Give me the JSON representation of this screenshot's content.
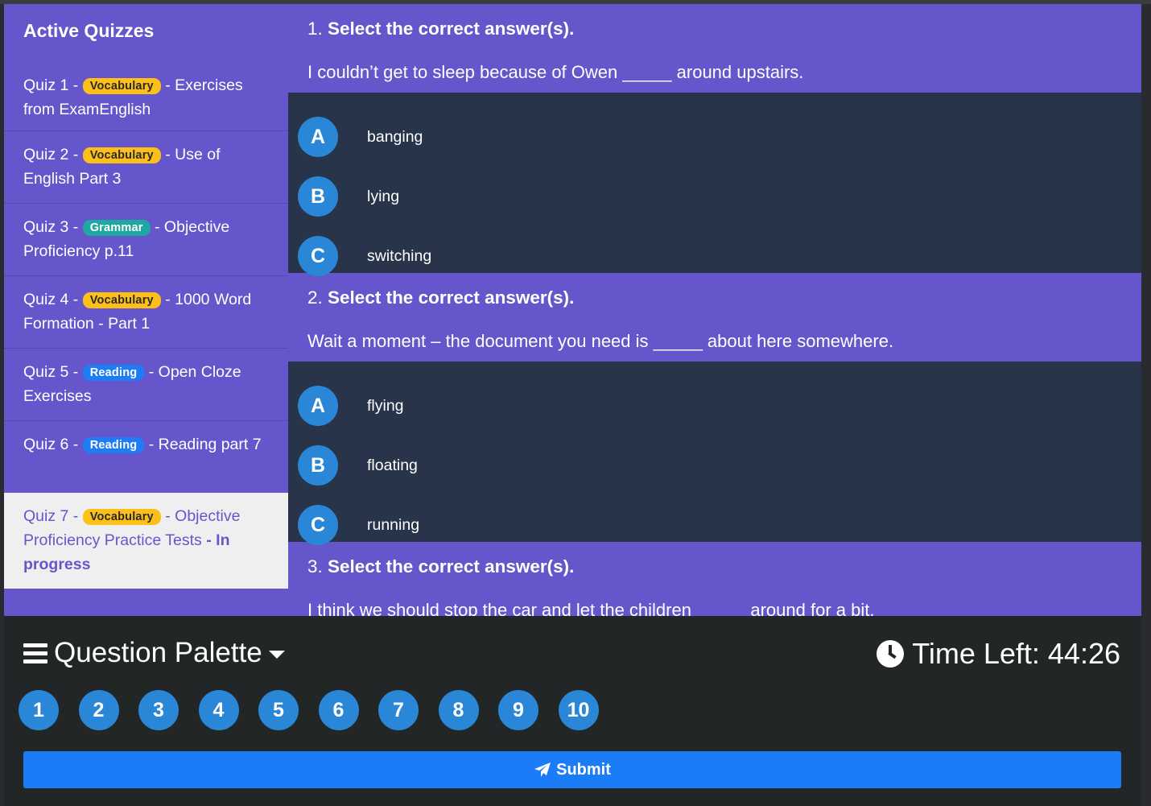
{
  "sidebar": {
    "title": "Active Quizzes",
    "items": [
      {
        "prefix": "Quiz 1 -",
        "badge": "Vocabulary",
        "rest": "- Exercises from ExamEnglish",
        "status": ""
      },
      {
        "prefix": "Quiz 2 -",
        "badge": "Vocabulary",
        "rest": "- Use of English Part 3",
        "status": ""
      },
      {
        "prefix": "Quiz 3 -",
        "badge": "Grammar",
        "rest": "- Objective Proficiency p.11",
        "status": ""
      },
      {
        "prefix": "Quiz 4 -",
        "badge": "Vocabulary",
        "rest": "- 1000 Word Formation - Part 1",
        "status": ""
      },
      {
        "prefix": "Quiz 5 -",
        "badge": "Reading",
        "rest": "- Open Cloze Exercises",
        "status": ""
      },
      {
        "prefix": "Quiz 6 -",
        "badge": "Reading",
        "rest": "- Reading part 7",
        "status": ""
      },
      {
        "prefix": "Quiz 7 -",
        "badge": "Vocabulary",
        "rest": "- Objective Proficiency Practice Tests",
        "status": "- In progress"
      }
    ]
  },
  "questions": [
    {
      "number": "1.",
      "title": "Select the correct answer(s).",
      "text": "I couldn’t get to sleep because of Owen _____ around upstairs.",
      "options": [
        {
          "letter": "A",
          "text": "banging"
        },
        {
          "letter": "B",
          "text": "lying"
        },
        {
          "letter": "C",
          "text": "switching"
        }
      ]
    },
    {
      "number": "2.",
      "title": "Select the correct answer(s).",
      "text": "Wait a moment – the document you need is _____ about here somewhere.",
      "options": [
        {
          "letter": "A",
          "text": "flying"
        },
        {
          "letter": "B",
          "text": "floating"
        },
        {
          "letter": "C",
          "text": "running"
        }
      ]
    },
    {
      "number": "3.",
      "title": "Select the correct answer(s).",
      "text": "I think we should stop the car and let the children _____ around for a bit."
    }
  ],
  "palette": {
    "title": "Question Palette",
    "numbers": [
      "1",
      "2",
      "3",
      "4",
      "5",
      "6",
      "7",
      "8",
      "9",
      "10"
    ]
  },
  "timer": {
    "label": "Time Left: 44:26"
  },
  "submit": {
    "label": "Submit"
  },
  "colors": {
    "accent": "#6656cc",
    "option_bg": "#273449",
    "circle": "#2a87d8",
    "submit": "#1a7cf6",
    "badge_vocabulary": "#fdc019",
    "badge_grammar": "#1fa7a1",
    "badge_reading": "#1e7cf5"
  },
  "icons": {
    "menu": "hamburger-icon",
    "dropdown": "caret-down-icon",
    "timer": "clock-icon",
    "submit": "paper-plane-icon"
  }
}
